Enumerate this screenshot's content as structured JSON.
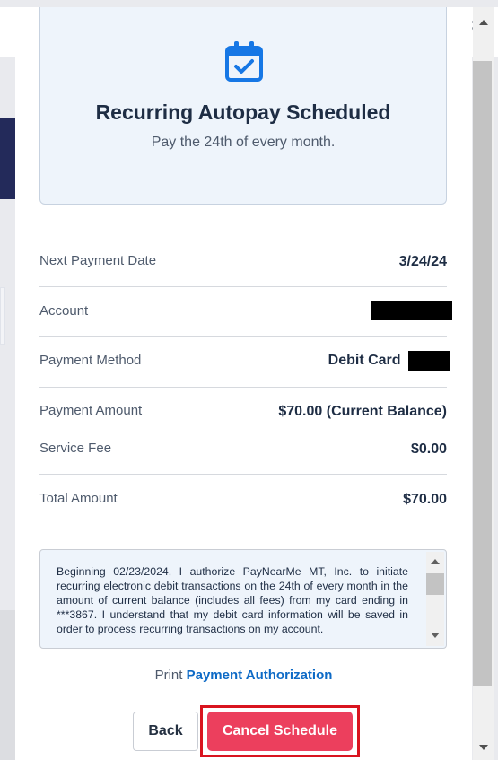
{
  "header": {
    "icon": "calendar-check-icon",
    "title": "Recurring Autopay Scheduled",
    "subtitle": "Pay the 24th of every month."
  },
  "details": {
    "next_payment_date": {
      "label": "Next Payment Date",
      "value": "3/24/24"
    },
    "account": {
      "label": "Account",
      "value": ""
    },
    "payment_method": {
      "label": "Payment Method",
      "value": "Debit Card"
    },
    "payment_amount": {
      "label": "Payment Amount",
      "value": "$70.00 (Current Balance)"
    },
    "service_fee": {
      "label": "Service Fee",
      "value": "$0.00"
    },
    "total_amount": {
      "label": "Total Amount",
      "value": "$70.00"
    }
  },
  "authorization": {
    "text": "Beginning 02/23/2024, I authorize PayNearMe MT, Inc. to initiate recurring electronic debit transactions on the 24th of every month in the amount of current balance (includes all fees) from my card ending in ***3867. I understand that my debit card information will be saved in order to process recurring transactions on my account."
  },
  "print": {
    "prefix": "Print",
    "link": "Payment Authorization"
  },
  "buttons": {
    "back": "Back",
    "cancel_schedule": "Cancel Schedule"
  },
  "colors": {
    "accent_blue": "#0d6ac6",
    "cancel_red": "#ec3f5d",
    "highlight_border": "#d9141f",
    "header_bg": "#eef4fb",
    "text_dark": "#1e2d44"
  }
}
